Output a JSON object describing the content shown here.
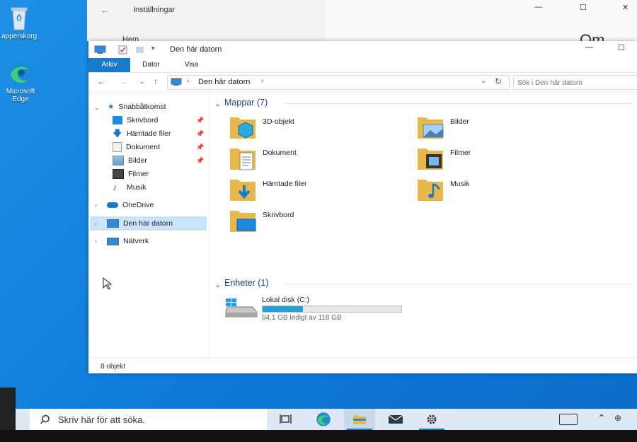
{
  "desktop": {
    "icons": [
      {
        "label": "apperskorg"
      },
      {
        "label": "Microsoft Edge"
      }
    ]
  },
  "settings_window": {
    "title": "Inställningar",
    "nav_item": "Hem",
    "page_heading": "Om"
  },
  "explorer": {
    "title": "Den här datorn",
    "ribbon_tabs": [
      "Arkiv",
      "Dator",
      "Visa"
    ],
    "address": "Den här datorn",
    "search_placeholder": "Sök i Den här datorn",
    "nav": {
      "quick_access": "Snabbåtkomst",
      "quick_items": [
        "Skrivbord",
        "Hämtade filer",
        "Dokument",
        "Bilder",
        "Filmer",
        "Musik"
      ],
      "onedrive": "OneDrive",
      "this_pc": "Den här datorn",
      "network": "Nätverk"
    },
    "folders_group": "Mappar (7)",
    "folders": [
      "3D-objekt",
      "Bilder",
      "Dokument",
      "Filmer",
      "Hämtade filer",
      "Musik",
      "Skrivbord"
    ],
    "devices_group": "Enheter (1)",
    "drive": {
      "name": "Lokal disk (C:)",
      "free_text": "84,1 GB ledigt av 118 GB",
      "used_fraction": 0.29
    },
    "status": "8 objekt"
  },
  "taskbar": {
    "search_placeholder": "Skriv här för att söka.",
    "icons": [
      "task-view-icon",
      "edge-icon",
      "file-explorer-icon",
      "mail-icon",
      "settings-icon"
    ]
  },
  "colors": {
    "accent": "#1979ca",
    "desktop": "#1482de",
    "folder": "#e8b84a"
  }
}
